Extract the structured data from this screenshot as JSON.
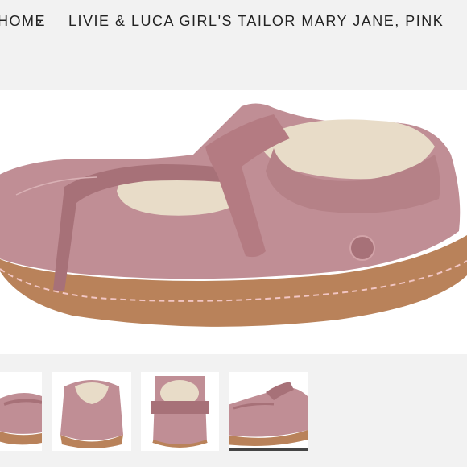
{
  "breadcrumb": {
    "home_label": "HOME",
    "separator": "›",
    "current": "LIVIE & LUCA GIRL'S TAILOR MARY JANE, PINK"
  },
  "product_image": {
    "icon": "mary-jane-shoe",
    "colors": {
      "leather": "#c08e95",
      "leather_dark": "#a77178",
      "sole": "#b9825a",
      "sole_dark": "#8e5c3a",
      "stitch": "#f2c6c4",
      "lining": "#e8dcc8"
    }
  },
  "gallery": {
    "thumbnail_count": 4,
    "active_index": 3
  },
  "colors": {
    "page_background": "#f2f2f2",
    "text": "#222222"
  }
}
